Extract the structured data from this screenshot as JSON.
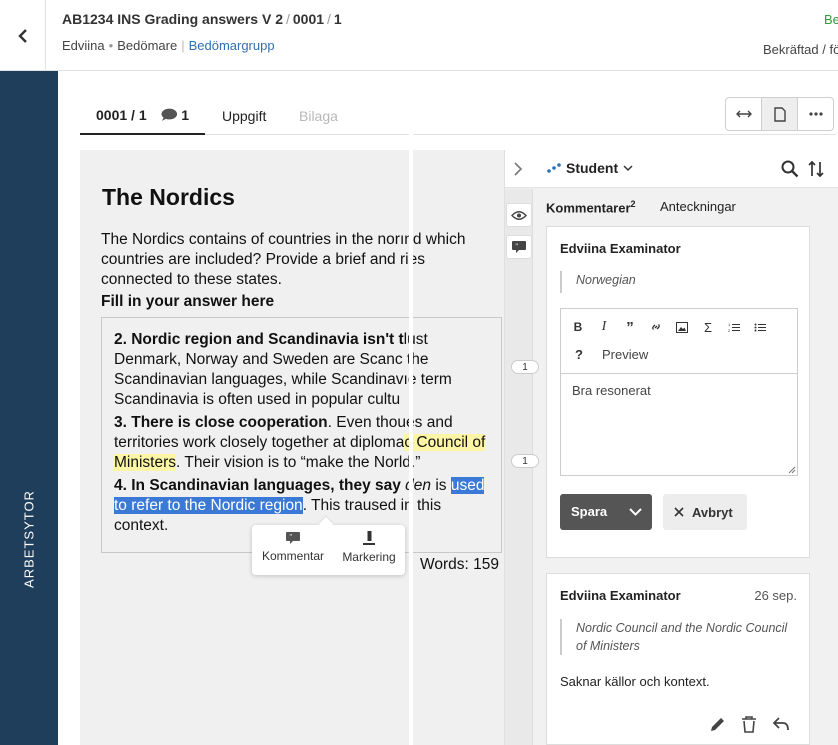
{
  "header": {
    "title": "AB1234 INS Grading answers V 2",
    "title_id": "0001",
    "title_num": "1",
    "sub_user": "Edviina",
    "sub_role": "Bedömare",
    "sub_group": "Bedömargrupp",
    "right_top": "Be",
    "right_bottom": "Bekräftad / fö"
  },
  "sidebar": {
    "label": "ARBETSYTOR"
  },
  "tabs": {
    "answer": "0001 / 1",
    "comment_count": "1",
    "task": "Uppgift",
    "attachments": "Bilaga"
  },
  "answer": {
    "heading": "The Nordics",
    "question": "The Nordics contains of countries in the norınd which countries are included? Provide a brief and ries connected to these states.",
    "fill_label": "Fill in your answer here",
    "p1_bold": "2. Nordic region and Scandinavia isn't t",
    "p1_rest": "lust Denmark, Norway and Sweden are Scanc the Scandinavian languages, while Scandinavıe term Scandinavia is often used in popular cultu",
    "p2_bold": "3. There is close cooperation",
    "p2_mid": ". Even thoues and territories work closely together at diploma",
    "p2_hl": "c Council of Ministers",
    "p2_end": ". Their vision is to “make the N",
    "p2_tail": "orld.”",
    "p3_bold": "4. In Scandinavian languages, they say ",
    "p3_it": "den",
    "p3_mid": " is ",
    "p3_sel": "used to refer to the Nordic region",
    "p3_end": ". This tra",
    "p3_tail": "used in this context.",
    "word_count": "Words: 159",
    "popup_comment": "Kommentar",
    "popup_mark": "Markering"
  },
  "right_panel": {
    "student_label": "Student",
    "tab_comments": "Kommentarer",
    "tab_comments_count": "2",
    "tab_notes": "Anteckningar",
    "marker_1": "1",
    "marker_2": "1",
    "edit_card": {
      "author": "Edviina Examinator",
      "quote": "Norwegian",
      "preview": "Preview",
      "help": "?",
      "text": "Bra resonerat",
      "save": "Spara",
      "cancel": "Avbryt"
    },
    "saved_card": {
      "author": "Edviina Examinator",
      "date": "26 sep.",
      "quote": "Nordic Council and the Nordic Council of Ministers",
      "body": "Saknar källor och kontext."
    }
  },
  "colors": {
    "sidebar": "#1e3e5c",
    "link": "#2f6fb3",
    "status_green": "#2e9e3e",
    "highlight_yellow": "#fdf5a6",
    "selection_blue": "#3b79d6"
  }
}
